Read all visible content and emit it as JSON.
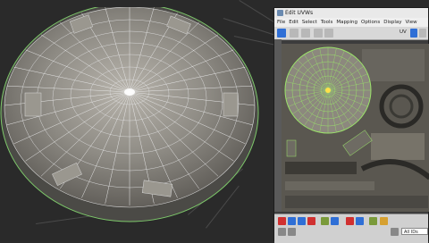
{
  "window": {
    "title": "Edit UVWs"
  },
  "menu": {
    "items": [
      "File",
      "Edit",
      "Select",
      "Tools",
      "Mapping",
      "Options",
      "Display",
      "View"
    ]
  },
  "toolbar": {
    "uv_label": "UV"
  },
  "bottom": {
    "field_value": "All IDs"
  },
  "colors": {
    "selection": "#9be36a",
    "wire": "#d8d8d8",
    "accent_blue": "#2f6fd6",
    "uv_vertex": "#ffe04a"
  }
}
